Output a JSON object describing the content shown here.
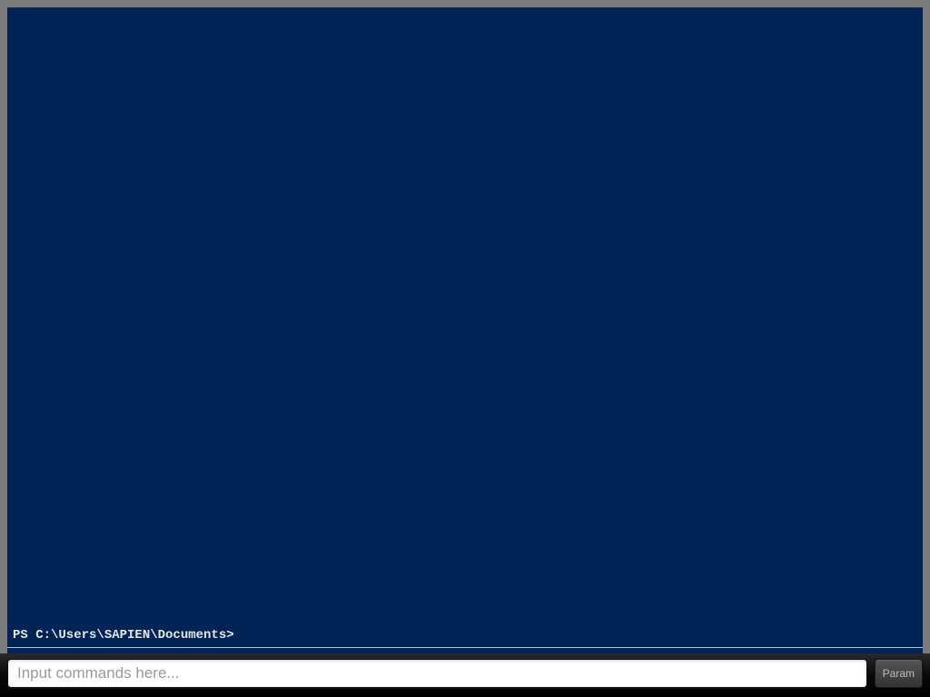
{
  "console": {
    "prompt": "PS C:\\Users\\SAPIEN\\Documents>"
  },
  "inputBar": {
    "placeholder": "Input commands here...",
    "value": "",
    "paramButton": "Param"
  }
}
